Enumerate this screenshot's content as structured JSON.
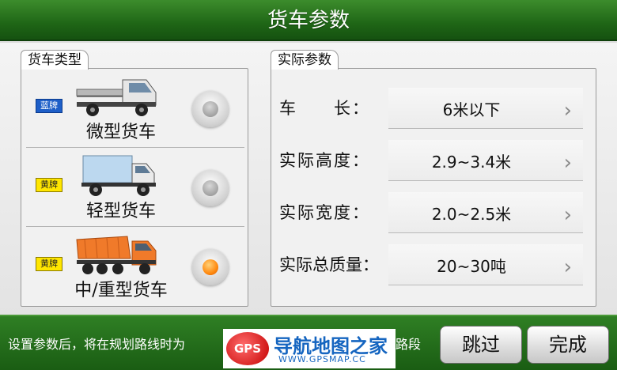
{
  "header": {
    "title": "货车参数"
  },
  "truck_type_panel": {
    "tab_label": "货车类型",
    "items": [
      {
        "plate": "蓝牌",
        "plate_color": "#1e5fc8",
        "label": "微型货车",
        "selected": false
      },
      {
        "plate": "黄牌",
        "plate_color": "#ffe600",
        "label": "轻型货车",
        "selected": false
      },
      {
        "plate": "黄牌",
        "plate_color": "#ffe600",
        "label": "中/重型货车",
        "selected": true
      }
    ]
  },
  "params_panel": {
    "tab_label": "实际参数",
    "rows": [
      {
        "label": "车　　长：",
        "value": "6米以下"
      },
      {
        "label": "实际高度：",
        "value": "2.9~3.4米"
      },
      {
        "label": "实际宽度：",
        "value": "2.0~2.5米"
      },
      {
        "label": "实际总质量：",
        "value": "20~30吨"
      }
    ]
  },
  "footer": {
    "hint": "设置参数后，将在规划路线时为",
    "hint_tail": "路段",
    "skip_label": "跳过",
    "done_label": "完成"
  },
  "watermark": {
    "logo": "GPS",
    "title": "导航地图之家",
    "url": "WWW.GPSMAP.CC"
  },
  "colors": {
    "accent_green": "#1f6616",
    "selected_radio": "#ff8a10"
  }
}
